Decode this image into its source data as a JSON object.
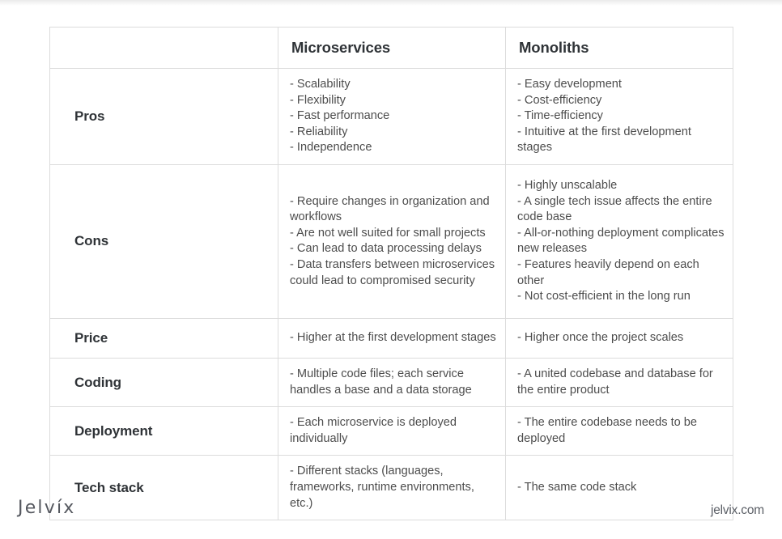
{
  "footer": {
    "logo": "Jelvíx",
    "site_url": "jelvix.com"
  },
  "table": {
    "columns": [
      {
        "key": "label",
        "label": ""
      },
      {
        "key": "microservices",
        "label": "Microservices"
      },
      {
        "key": "monoliths",
        "label": "Monoliths"
      }
    ],
    "rows": [
      {
        "label": "Pros",
        "microservices": [
          "- Scalability",
          "- Flexibility",
          "- Fast performance",
          "- Reliability",
          "- Independence"
        ],
        "monoliths": [
          "- Easy development",
          "- Cost-efficiency",
          "- Time-efficiency",
          "- Intuitive at the first development stages"
        ]
      },
      {
        "label": "Cons",
        "microservices": [
          "- Require changes in organization and workflows",
          "- Are not well suited for small projects",
          "- Can lead to data processing delays",
          "- Data transfers between microservices could lead to compromised security"
        ],
        "monoliths": [
          "- Highly unscalable",
          "- A single tech issue affects the entire code base",
          "- All-or-nothing deployment complicates new releases",
          "- Features heavily depend on each other",
          "- Not cost-efficient in the long run"
        ]
      },
      {
        "label": "Price",
        "microservices": [
          "- Higher at the first development stages"
        ],
        "monoliths": [
          "- Higher once the project scales"
        ]
      },
      {
        "label": "Coding",
        "microservices": [
          "- Multiple code files; each service handles a base and a data storage"
        ],
        "monoliths": [
          "- A united codebase and database for the entire product"
        ]
      },
      {
        "label": "Deployment",
        "microservices": [
          "- Each microservice is deployed individually"
        ],
        "monoliths": [
          "- The entire codebase needs to be deployed"
        ]
      },
      {
        "label": "Tech stack",
        "microservices": [
          "- Different stacks (languages, frameworks, runtime environments, etc.)"
        ],
        "monoliths": [
          "- The same code stack"
        ]
      }
    ]
  },
  "colors": {
    "heading_text": "#2f3337",
    "body_text": "#4d4d4d",
    "border": "#dcdcdc",
    "background": "#ffffff",
    "footer_text": "#5b5f66"
  }
}
